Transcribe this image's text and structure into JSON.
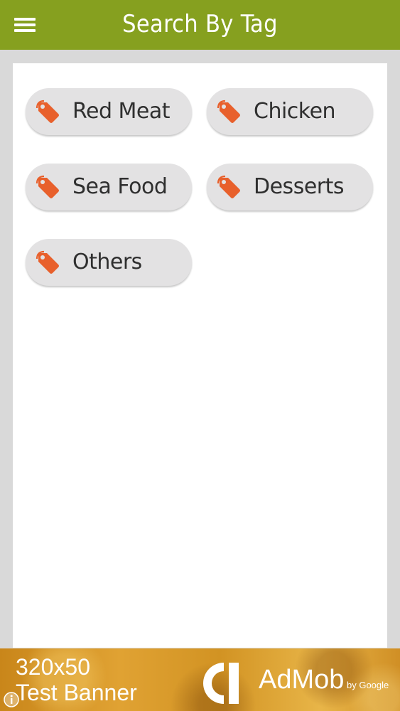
{
  "app_bar": {
    "title": "Search By Tag",
    "menu_icon": "hamburger-menu-icon",
    "background_color": "#86a01f"
  },
  "tags": [
    {
      "label": "Red Meat",
      "icon": "tag-icon"
    },
    {
      "label": "Chicken",
      "icon": "tag-icon"
    },
    {
      "label": "Sea Food",
      "icon": "tag-icon"
    },
    {
      "label": "Desserts",
      "icon": "tag-icon"
    },
    {
      "label": "Others",
      "icon": "tag-icon"
    }
  ],
  "tag_icon_color": "#e8602c",
  "ad": {
    "size_label": "320x50",
    "title": "Test Banner",
    "brand": "AdMob",
    "by": "by Google",
    "info_icon": "info-icon"
  }
}
